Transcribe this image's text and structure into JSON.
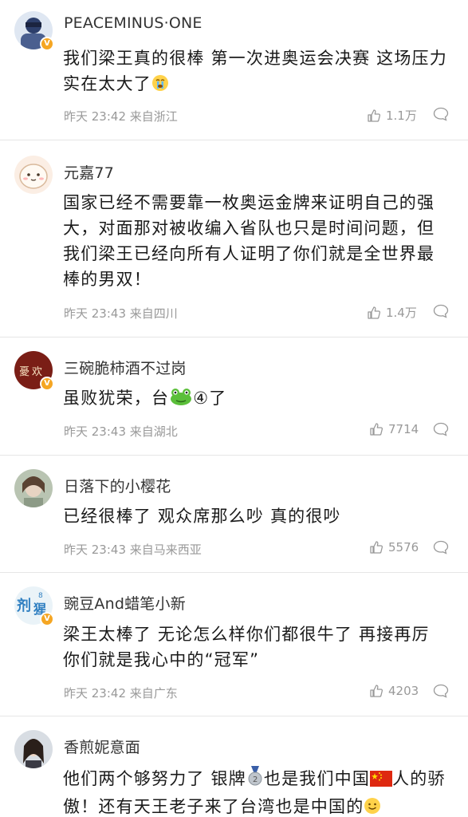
{
  "comments": [
    {
      "username": "PEACEMINUS·ONE",
      "text": "我们梁王真的很棒 第一次进奥运会决赛 这场压力实在太大了",
      "emoji_trailing": "crying-face",
      "time": "昨天 23:42",
      "location": "来自浙江",
      "likes": "1.1万",
      "verified": true
    },
    {
      "username": "元嘉77",
      "text": "国家已经不需要靠一枚奥运金牌来证明自己的强大，对面那对被收编入省队也只是时间问题，但我们梁王已经向所有人证明了你们就是全世界最棒的男双！",
      "time": "昨天 23:43",
      "location": "来自四川",
      "likes": "1.4万",
      "verified": false
    },
    {
      "username": "三碗脆柿酒不过岗",
      "text_before": "虽败犹荣，台",
      "text_after": "④了",
      "emoji_inline": "frog",
      "time": "昨天 23:43",
      "location": "来自湖北",
      "likes": "7714",
      "verified": true
    },
    {
      "username": "日落下的小樱花",
      "text": "已经很棒了 观众席那么吵 真的很吵",
      "time": "昨天 23:43",
      "location": "来自马来西亚",
      "likes": "5576",
      "verified": false
    },
    {
      "username": "豌豆And蜡笔小新",
      "text": "梁王太棒了 无论怎么样你们都很牛了 再接再厉 你们就是我心中的“冠军”",
      "time": "昨天 23:42",
      "location": "来自广东",
      "likes": "4203",
      "verified": true
    },
    {
      "username": "香煎妮意面",
      "text_1": "他们两个够努力了 银牌",
      "text_2": "也是我们中国",
      "text_3": "人的骄傲！还有天王老子来了台湾也是中国的",
      "emoji_medal": "silver-medal-2",
      "emoji_flag": "china-flag",
      "emoji_end": "smiling-face",
      "verified": false
    }
  ],
  "colors": {
    "text": "#1a1a1a",
    "meta": "#999999",
    "divider": "#e6e6e6",
    "verified_badge": "#f5a623"
  }
}
